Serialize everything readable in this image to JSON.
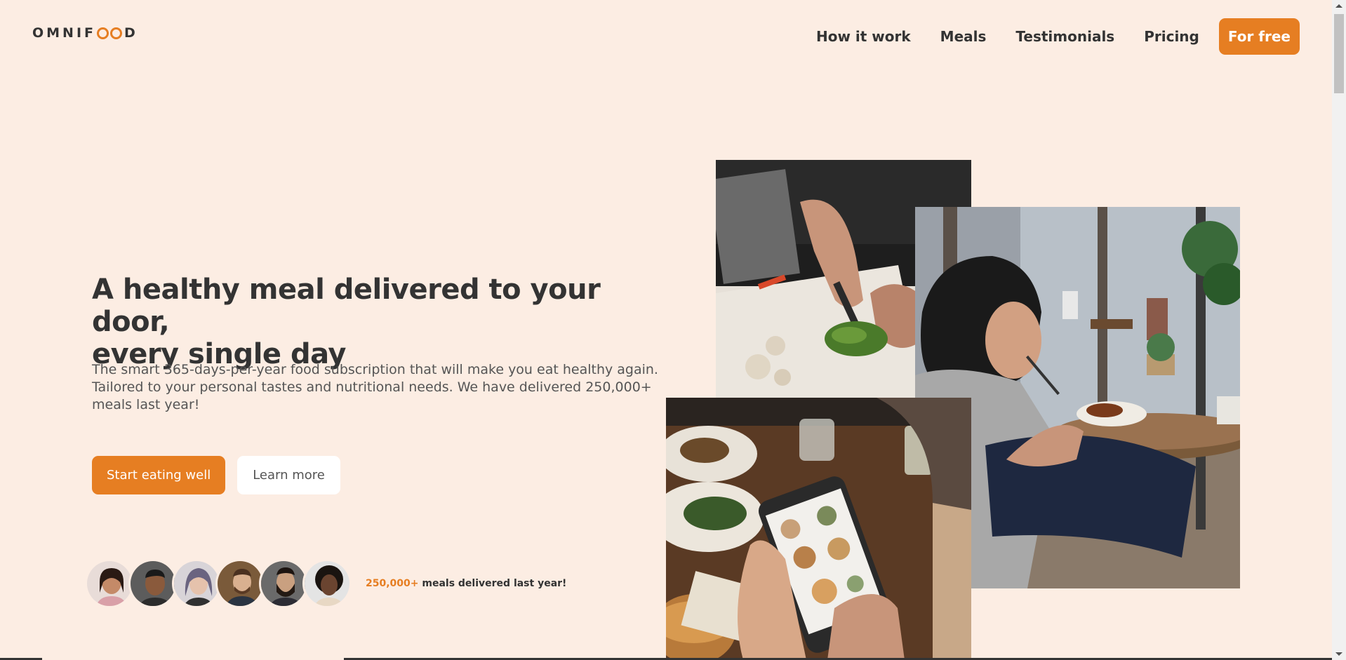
{
  "header": {
    "logo_text_left": "OMNIF",
    "logo_text_right": "D",
    "nav": [
      {
        "label": "How it work"
      },
      {
        "label": "Meals"
      },
      {
        "label": "Testimonials"
      },
      {
        "label": "Pricing"
      }
    ],
    "cta_label": "For free"
  },
  "hero": {
    "title_line1": "A healthy meal delivered to your door,",
    "title_line2": "every single day",
    "description": "The smart 365-days-per-year food subscription that will make you eat healthy again. Tailored to your personal tastes and nutritional needs. We have delivered 250,000+ meals last year!",
    "primary_button": "Start eating well",
    "secondary_button": "Learn more"
  },
  "delivered": {
    "highlight": "250,000+",
    "text": " meals delivered last year!"
  },
  "colors": {
    "background": "#fcede3",
    "accent": "#e67e22",
    "text": "#333333"
  }
}
